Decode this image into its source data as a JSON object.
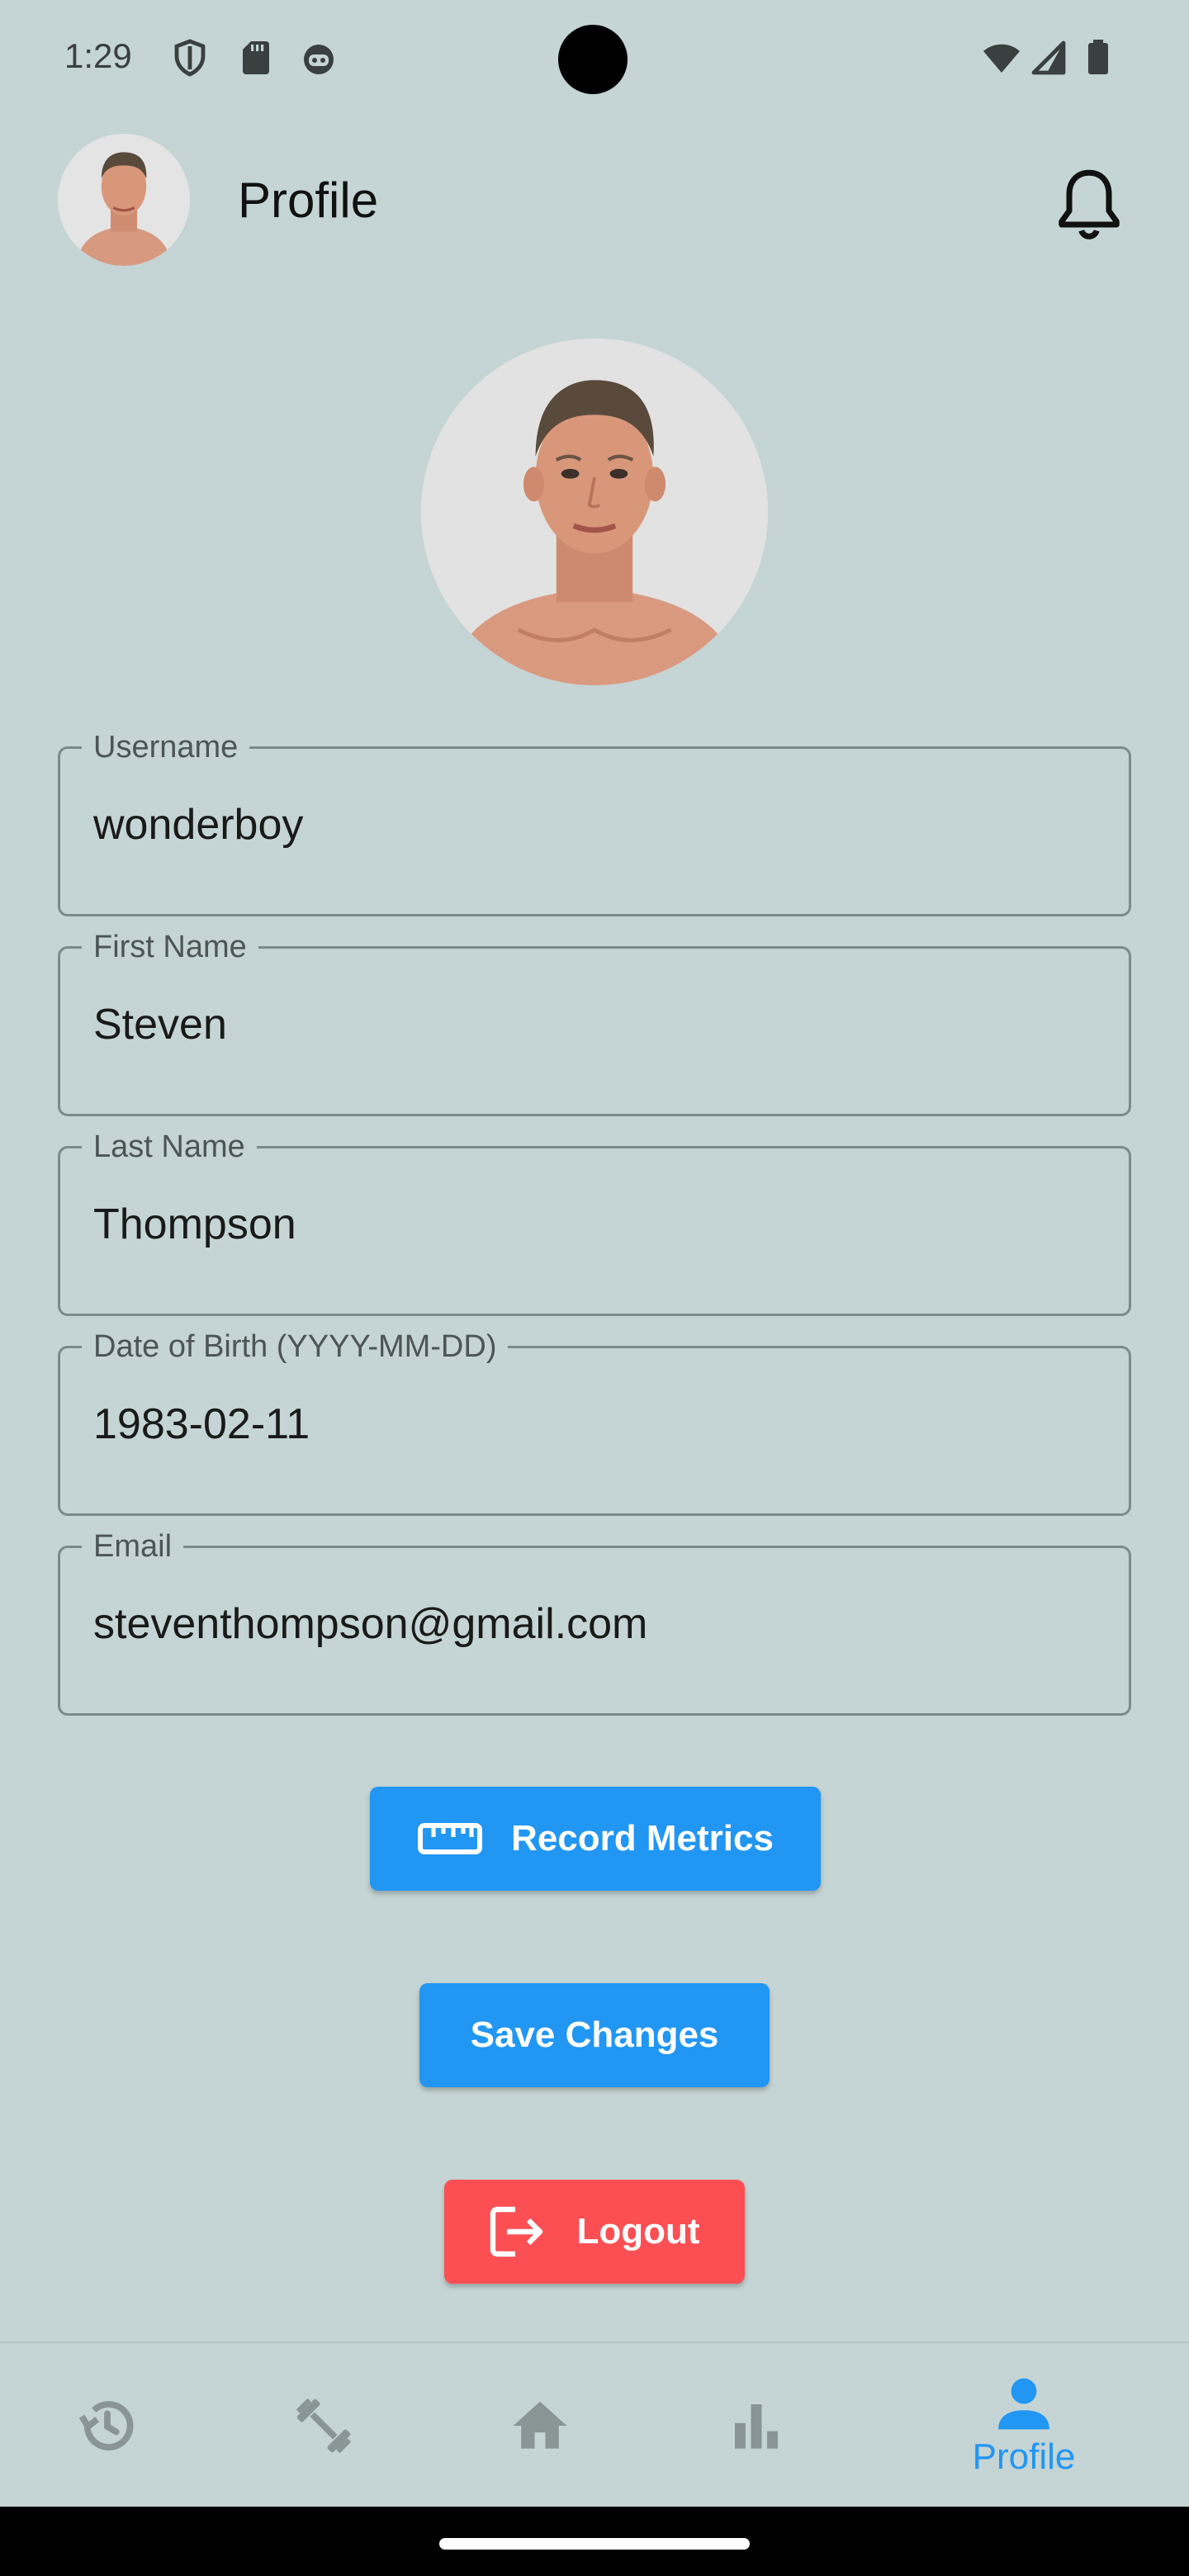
{
  "status_bar": {
    "time": "1:29",
    "icons_left": [
      "shield-icon",
      "sd-card-icon",
      "robot-face-icon"
    ],
    "icons_right": [
      "wifi-icon",
      "cell-signal-icon",
      "battery-icon"
    ]
  },
  "app_bar": {
    "title": "Profile",
    "avatar_icon": "user-avatar",
    "notification_icon": "bell-icon"
  },
  "form": {
    "username": {
      "label": "Username",
      "value": "wonderboy"
    },
    "first_name": {
      "label": "First Name",
      "value": "Steven"
    },
    "last_name": {
      "label": "Last Name",
      "value": "Thompson"
    },
    "dob": {
      "label": "Date of Birth (YYYY-MM-DD)",
      "value": "1983-02-11"
    },
    "email": {
      "label": "Email",
      "value": "steventhompson@gmail.com"
    }
  },
  "buttons": {
    "record_metrics": "Record Metrics",
    "save_changes": "Save Changes",
    "logout": "Logout"
  },
  "bottom_nav": {
    "items": [
      {
        "icon": "history-icon",
        "label": "",
        "active": false
      },
      {
        "icon": "fitness-icon",
        "label": "",
        "active": false
      },
      {
        "icon": "home-icon",
        "label": "",
        "active": false
      },
      {
        "icon": "bar-chart-icon",
        "label": "",
        "active": false
      },
      {
        "icon": "person-icon",
        "label": "Profile",
        "active": true
      }
    ]
  },
  "colors": {
    "background": "#c5d4d4",
    "primary": "#2196f3",
    "danger": "#fb4f53",
    "nav_inactive": "#8a9595"
  }
}
